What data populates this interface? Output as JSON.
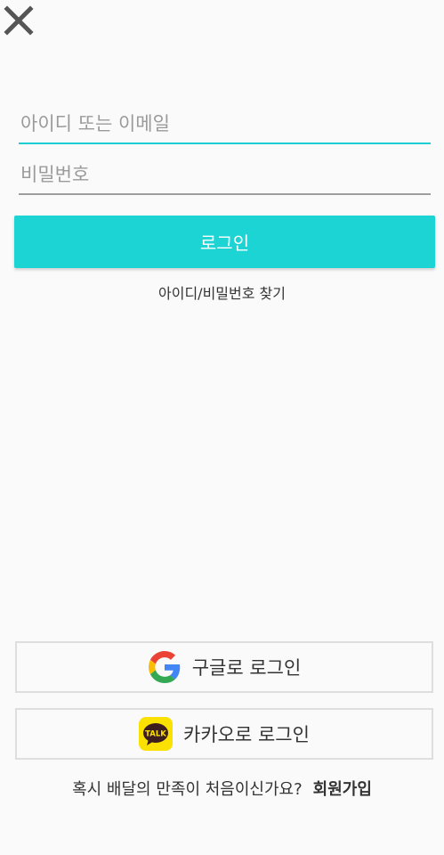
{
  "header": {
    "close_icon": "close-icon"
  },
  "form": {
    "id_placeholder": "아이디 또는 이메일",
    "password_placeholder": "비밀번호",
    "login_label": "로그인",
    "find_link": "아이디/비밀번호 찾기"
  },
  "social": {
    "google_label": "구글로 로그인",
    "google_icon": "google-icon",
    "kakao_label": "카카오로 로그인",
    "kakao_icon": "kakao-talk-icon",
    "kakao_icon_text": "TALK"
  },
  "footer": {
    "question": "혹시 배달의 만족이 처음이신가요?",
    "signup_label": "회원가입"
  },
  "colors": {
    "accent": "#1dd4d4",
    "focus_underline": "#1dcdd4",
    "kakao_yellow": "#fae100"
  }
}
